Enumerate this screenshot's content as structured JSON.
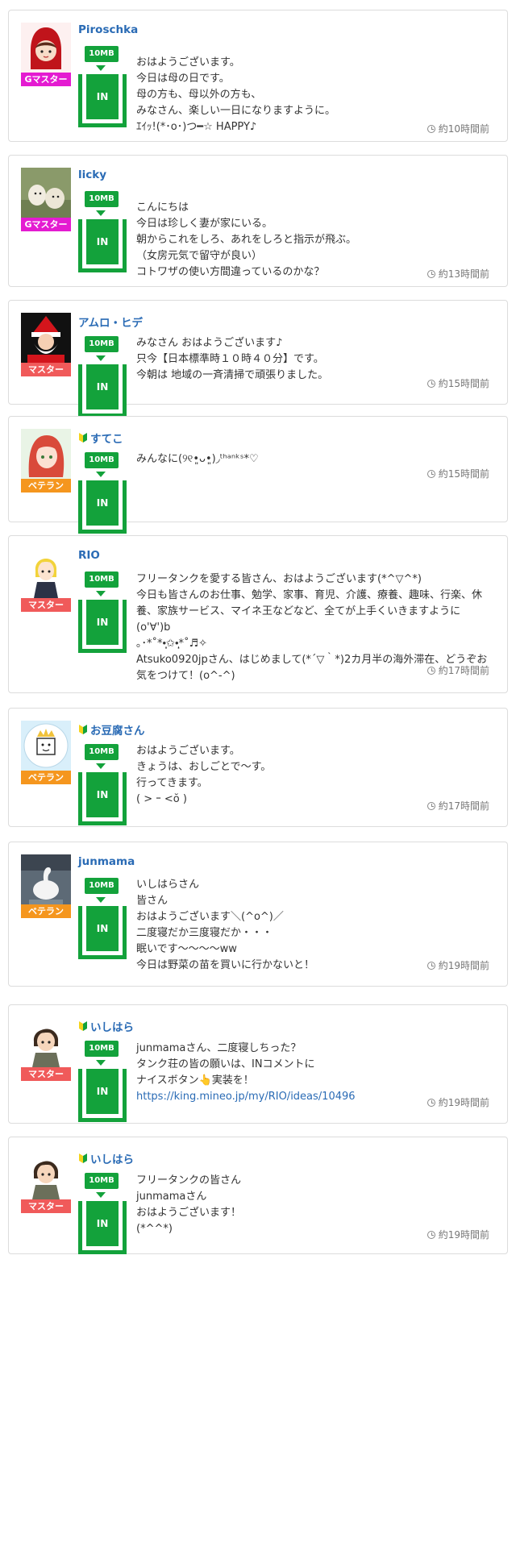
{
  "posts": [
    {
      "username": "Piroschka",
      "rank": "Gマスター",
      "rank_color": "#e41bd1",
      "beginner": false,
      "tag": "10MB",
      "in_label": "IN",
      "lines": [
        "おはようございます。",
        "今日は母の日です。",
        "母の方も、母以外の方も、",
        "みなさん、楽しい一日になりますように。",
        "ｴｲｯ!(*･o･)つ━☆ HAPPY♪"
      ],
      "time": "約10時間前",
      "avatar_icon": "red-hood-girl-icon"
    },
    {
      "username": "licky",
      "rank": "Gマスター",
      "rank_color": "#e41bd1",
      "beginner": false,
      "tag": "10MB",
      "in_label": "IN",
      "lines": [
        "こんにちは",
        "今日は珍しく妻が家にいる。",
        "朝からこれをしろ、あれをしろと指示が飛ぶ。",
        "（女房元気で留守が良い）",
        "コトワザの使い方間違っているのかな？"
      ],
      "time": "約13時間前",
      "avatar_icon": "dogs-photo-icon"
    },
    {
      "username": "アムロ・ヒデ",
      "rank": "マスター",
      "rank_color": "#f05a5a",
      "beginner": false,
      "tag": "10MB",
      "in_label": "IN",
      "lines": [
        "みなさん おはようございます♪",
        "只今【日本標準時１０時４０分】です。",
        "今朝は 地域の一斉清掃で頑張りました。"
      ],
      "time": "約15時間前",
      "avatar_icon": "santa-icon"
    },
    {
      "username": "すてこ",
      "rank": "ベテラン",
      "rank_color": "#f5961e",
      "beginner": true,
      "tag": "10MB",
      "in_label": "IN",
      "lines": [
        "みんなに(୨୧•͈ᴗ•͈)◞ᵗʰᵃⁿᵏˢ*♡"
      ],
      "time": "約15時間前",
      "avatar_icon": "anime-girl-icon"
    },
    {
      "username": "RIO",
      "rank": "マスター",
      "rank_color": "#f05a5a",
      "beginner": false,
      "tag": "10MB",
      "in_label": "IN",
      "lines": [
        "フリータンクを愛する皆さん、おはようございます(*^▽^*)",
        "今日も皆さんのお仕事、勉学、家事、育児、介護、療養、趣味、行楽、休養、家族サービス、マイネ王などなど、全てが上手くいきますように(o'∀')b",
        "｡･*˚*•̩̩͙✩•̩̩͙*˚♬✧",
        "Atsuko0920jpさん、はじめまして(*´▽｀*)2カ月半の海外滞在、どうぞお気をつけて！(o^-^)"
      ],
      "time": "約17時間前",
      "avatar_icon": "blonde-character-icon"
    },
    {
      "username": "お豆腐さん",
      "rank": "ベテラン",
      "rank_color": "#f5961e",
      "beginner": true,
      "tag": "10MB",
      "in_label": "IN",
      "lines": [
        "おはようございます。",
        "きょうは、おしごとで〜す。",
        "行ってきます。",
        "( > ｰ <ŏ )"
      ],
      "time": "約17時間前",
      "avatar_icon": "tofu-character-icon"
    },
    {
      "username": "junmama",
      "rank": "ベテラン",
      "rank_color": "#f5961e",
      "beginner": false,
      "tag": "10MB",
      "in_label": "IN",
      "lines": [
        "いしはらさん",
        "皆さん",
        "おはようございます＼(^o^)／",
        "二度寝だか三度寝だか・・・",
        "眠いです〜〜〜〜ww",
        "今日は野菜の苗を買いに行かないと！"
      ],
      "time": "約19時間前",
      "avatar_icon": "swan-photo-icon"
    },
    {
      "username": "いしはら",
      "rank": "マスター",
      "rank_color": "#f05a5a",
      "beginner": true,
      "tag": "10MB",
      "in_label": "IN",
      "lines": [
        "junmamaさん、二度寝しちった？",
        "タンク荘の皆の願いは、INコメントに",
        "ナイスボタン👆実装を！"
      ],
      "link": "https://king.mineo.jp/my/RIO/ideas/10496",
      "time": "約19時間前",
      "avatar_icon": "boy-character-icon"
    },
    {
      "username": "いしはら",
      "rank": "マスター",
      "rank_color": "#f05a5a",
      "beginner": true,
      "tag": "10MB",
      "in_label": "IN",
      "lines": [
        "フリータンクの皆さん",
        "junmamaさん",
        "おはようございます！",
        "(*^^*)"
      ],
      "time": "約19時間前",
      "avatar_icon": "boy-character-icon"
    }
  ]
}
